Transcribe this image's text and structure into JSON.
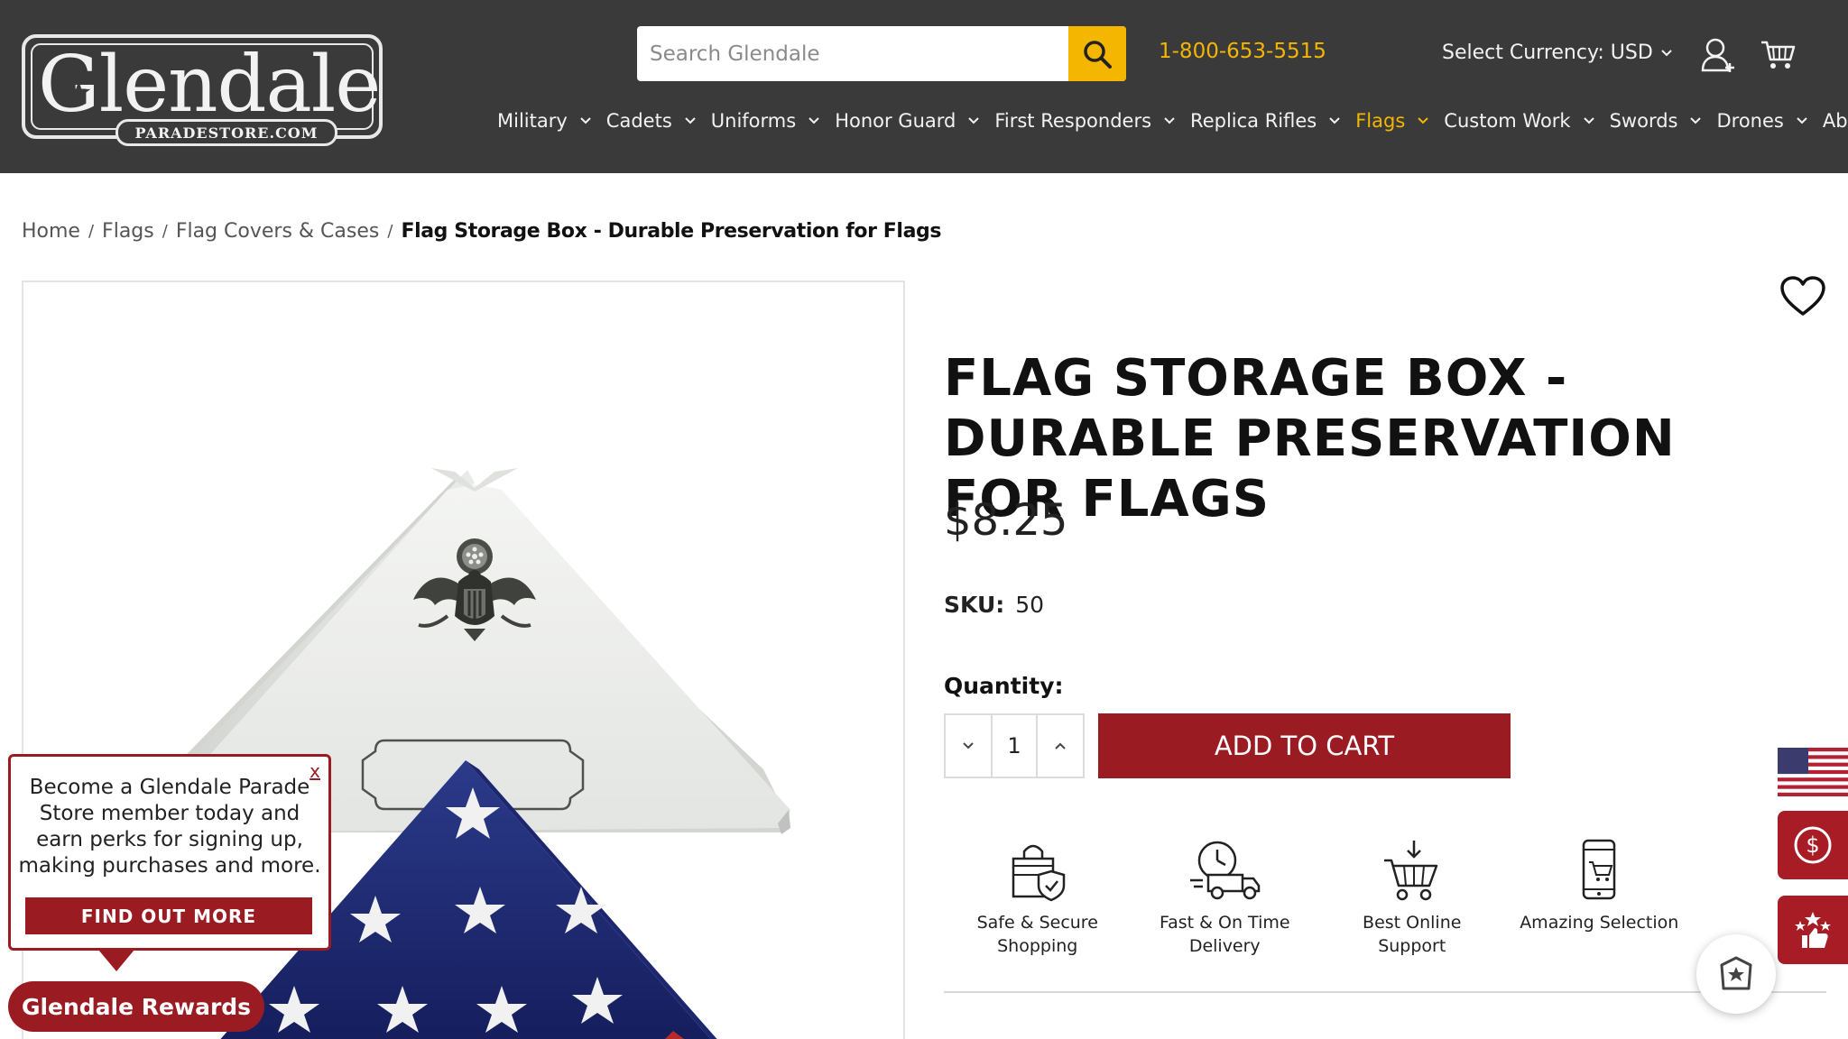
{
  "header": {
    "logo": {
      "word": "Glendale",
      "sub": "PARADESTORE.COM"
    },
    "search": {
      "placeholder": "Search Glendale",
      "value": ""
    },
    "phone": "1-800-653-5515",
    "currency_label": "Select Currency: USD",
    "nav": [
      {
        "label": "Military",
        "active": false
      },
      {
        "label": "Cadets",
        "active": false
      },
      {
        "label": "Uniforms",
        "active": false
      },
      {
        "label": "Honor Guard",
        "active": false
      },
      {
        "label": "First Responders",
        "active": false
      },
      {
        "label": "Replica Rifles",
        "active": false
      },
      {
        "label": "Flags",
        "active": true
      },
      {
        "label": "Custom Work",
        "active": false
      },
      {
        "label": "Swords",
        "active": false
      },
      {
        "label": "Drones",
        "active": false
      },
      {
        "label": "About Us",
        "active": false
      }
    ]
  },
  "breadcrumb": {
    "items": [
      "Home",
      "Flags",
      "Flag Covers & Cases"
    ],
    "separator": "/",
    "current": "Flag Storage Box - Durable Preservation for Flags"
  },
  "product": {
    "title": "Flag Storage Box - Durable Preservation for Flags",
    "price": "$8.25",
    "sku_label": "SKU:",
    "sku": "50",
    "quantity_label": "Quantity:",
    "quantity": "1",
    "add_to_cart": "ADD TO CART",
    "features": [
      {
        "icon": "secure-bag-icon",
        "label": "Safe & Secure Shopping"
      },
      {
        "icon": "delivery-truck-icon",
        "label": "Fast & On Time Delivery"
      },
      {
        "icon": "shopping-cart-support-icon",
        "label": "Best Online Support"
      },
      {
        "icon": "mobile-shopping-icon",
        "label": "Amazing Selection"
      }
    ]
  },
  "popup": {
    "close": "x",
    "text": "Become a Glendale Parade Store member today and earn perks for signing up, making purchases and more.",
    "button": "FIND OUT MORE"
  },
  "rewards_button": "Glendale Rewards",
  "colors": {
    "header_bg": "#3a3a3a",
    "accent_yellow": "#f5b600",
    "brand_red": "#9b1b22"
  }
}
